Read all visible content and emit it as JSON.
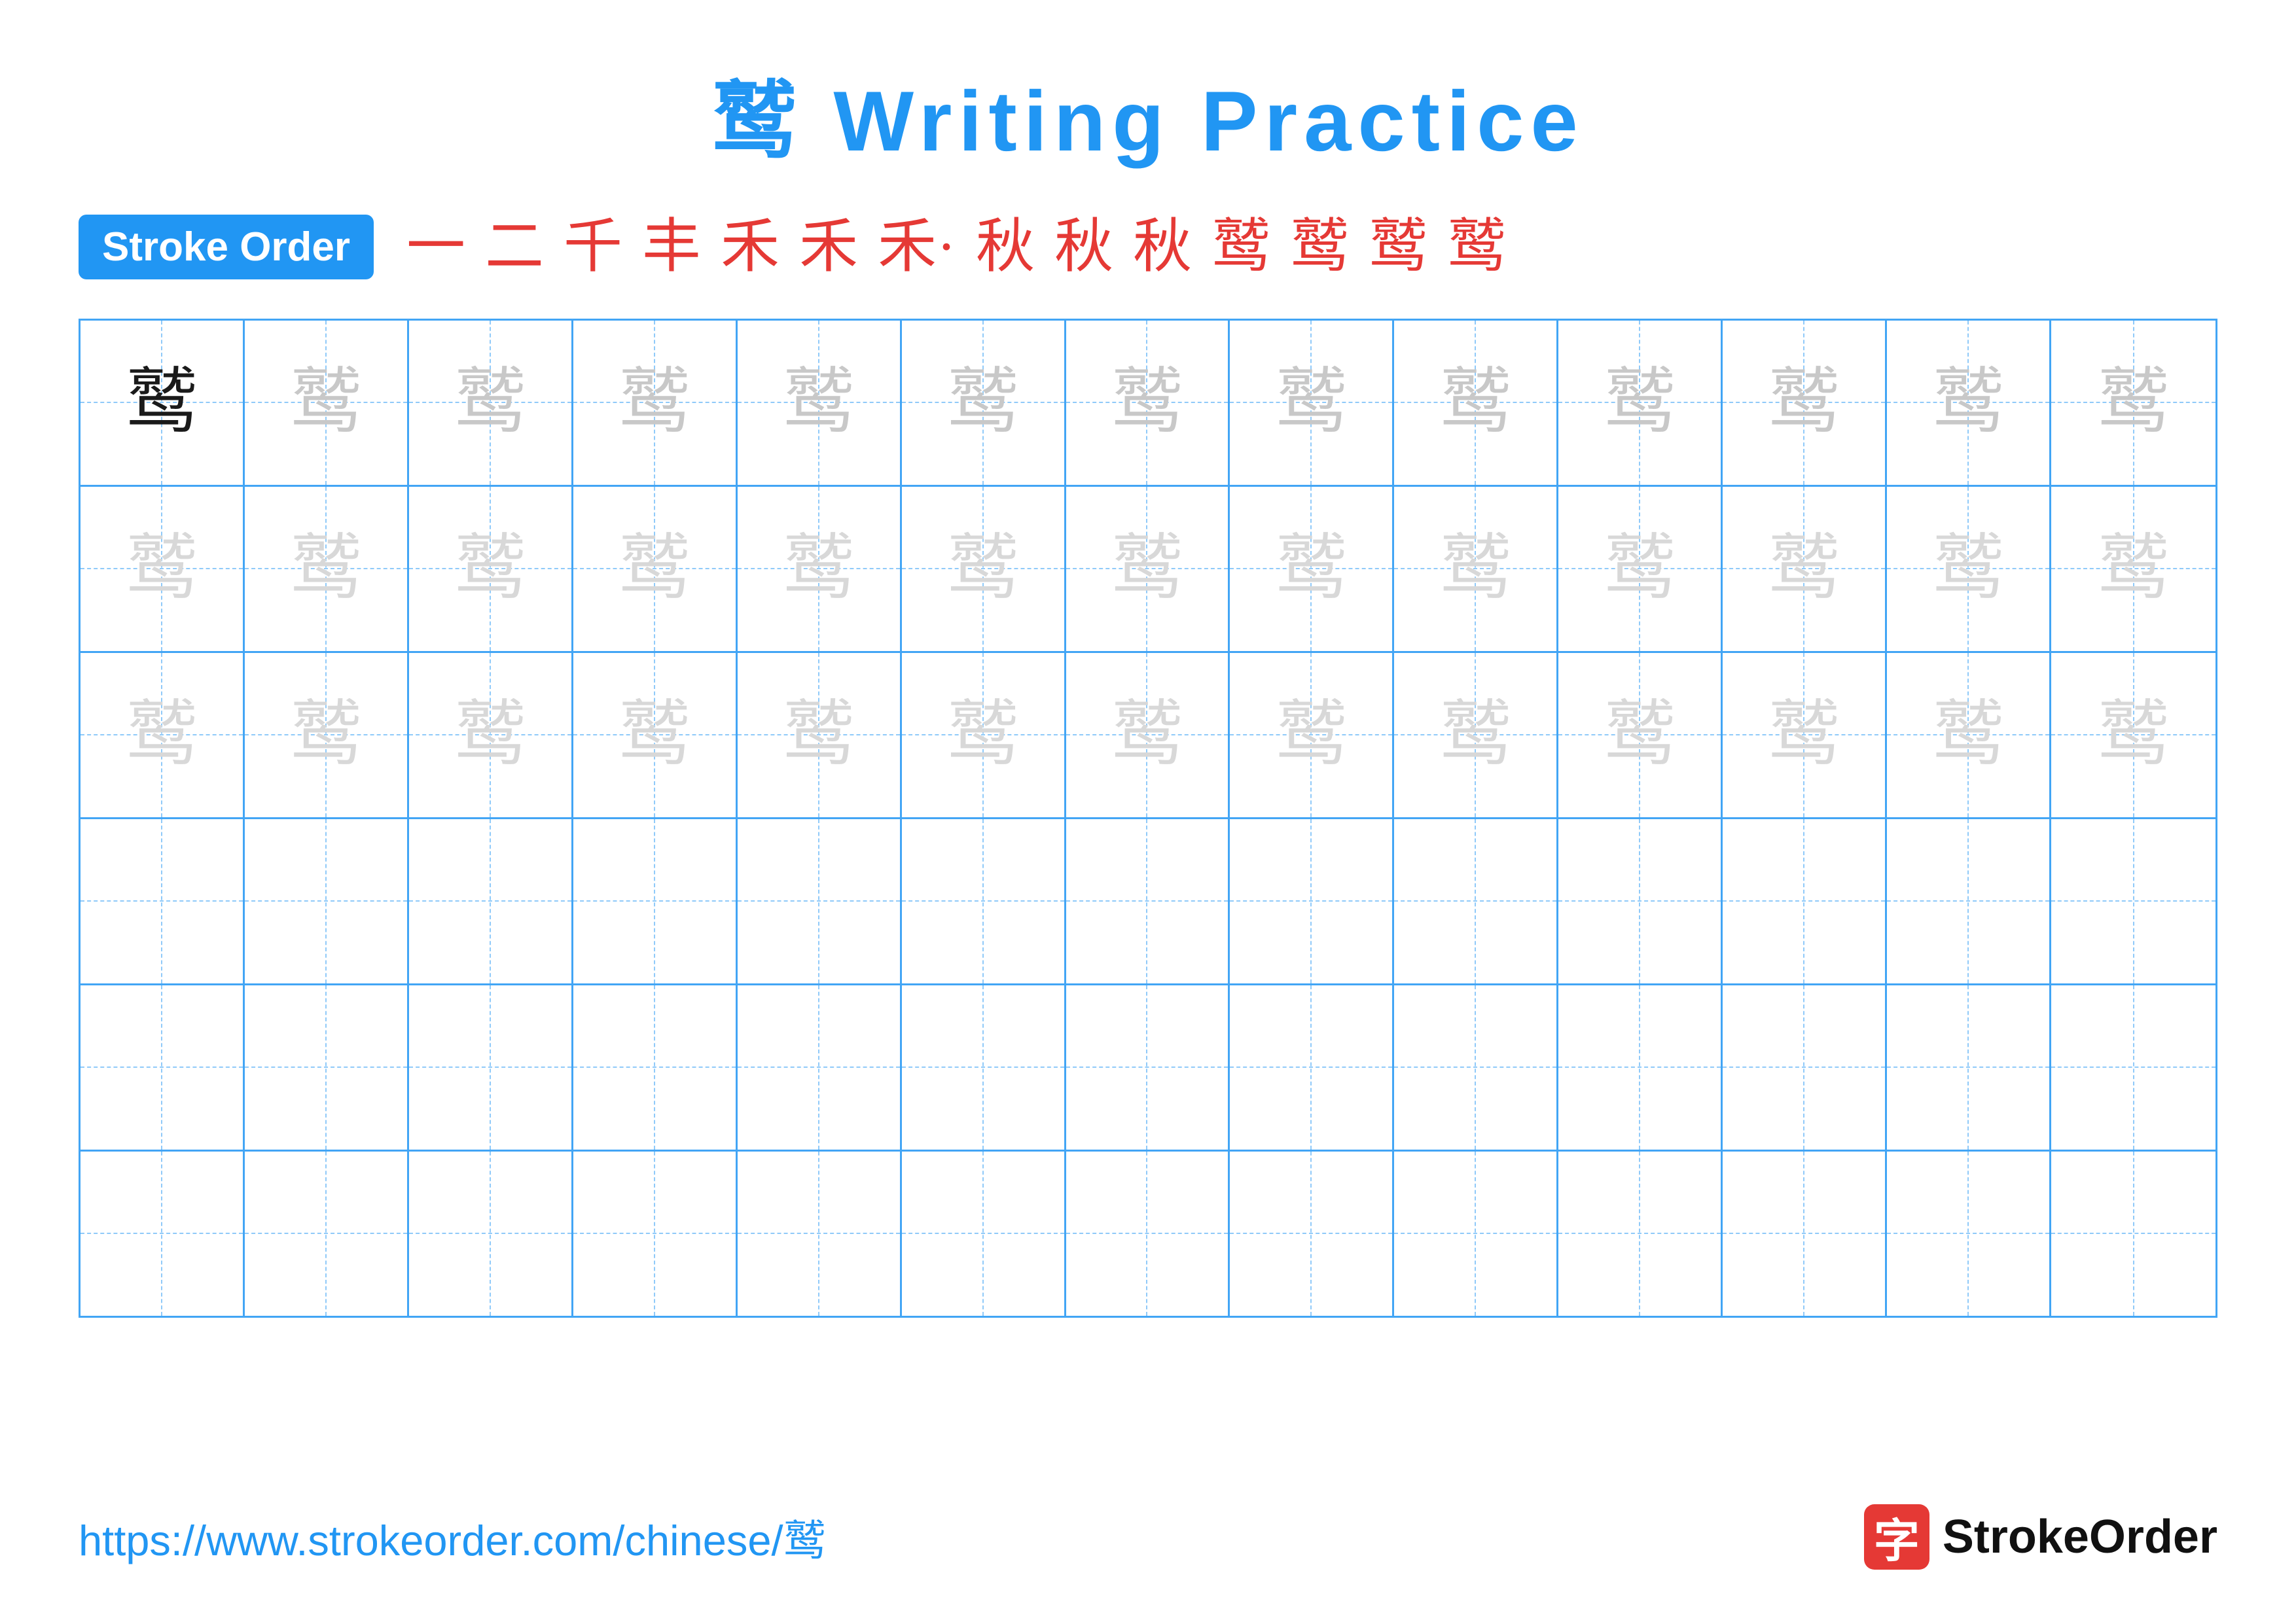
{
  "title": {
    "character": "鹫",
    "label": "Writing Practice",
    "full": "鹫 Writing Practice"
  },
  "stroke_order": {
    "badge_label": "Stroke Order",
    "strokes": [
      "一",
      "二",
      "千",
      "丰",
      "禾",
      "禾",
      "禾·",
      "秋",
      "秋",
      "秋",
      "鹫",
      "鹫",
      "鹫",
      "鹫"
    ]
  },
  "grid": {
    "rows": 6,
    "cols": 13,
    "character": "鹫",
    "row_types": [
      "dark_then_light",
      "lighter",
      "lighter",
      "empty",
      "empty",
      "empty"
    ]
  },
  "footer": {
    "url": "https://www.strokeorder.com/chinese/鹫",
    "logo_icon": "字",
    "logo_text": "StrokeOrder"
  },
  "colors": {
    "blue": "#2196F3",
    "red": "#e53935",
    "dark": "#1a1a1a",
    "light_char": "#c8c8c8",
    "lighter_char": "#d8d8d8",
    "grid_border": "#42A5F5",
    "grid_dashed": "#90CAF9"
  }
}
